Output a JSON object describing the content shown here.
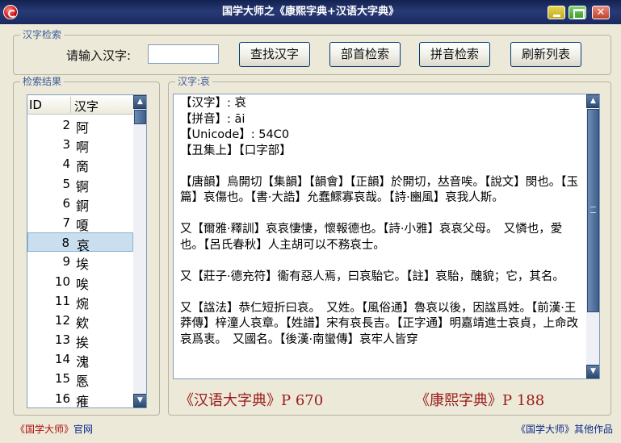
{
  "window": {
    "title": "国学大师之《康熙字典+汉语大字典》",
    "close_glyph": "✕",
    "colors": {
      "titlebar": "#1a2a60",
      "accent": "#9a1a1a",
      "selection": "#c9dff0"
    }
  },
  "search": {
    "group_label": "汉字检索",
    "prompt": "请输入汉字:",
    "input_value": "",
    "buttons": {
      "lookup": "查找汉字",
      "radical": "部首检索",
      "pinyin": "拼音检索",
      "refresh": "刷新列表"
    }
  },
  "results": {
    "group_label": "检索结果",
    "columns": [
      "ID",
      "汉字"
    ],
    "rows": [
      {
        "id": "2",
        "char": "阿"
      },
      {
        "id": "3",
        "char": "啊"
      },
      {
        "id": "4",
        "char": "啇"
      },
      {
        "id": "5",
        "char": "锕"
      },
      {
        "id": "6",
        "char": "錒"
      },
      {
        "id": "7",
        "char": "嗄"
      },
      {
        "id": "8",
        "char": "哀"
      },
      {
        "id": "9",
        "char": "埃"
      },
      {
        "id": "10",
        "char": "唉"
      },
      {
        "id": "11",
        "char": "焥"
      },
      {
        "id": "12",
        "char": "欸"
      },
      {
        "id": "13",
        "char": "挨"
      },
      {
        "id": "14",
        "char": "溾"
      },
      {
        "id": "15",
        "char": "悘"
      },
      {
        "id": "16",
        "char": "痽"
      }
    ],
    "selected_index": 6
  },
  "detail": {
    "group_label": "汉字:哀",
    "lines": [
      "【汉字】: 哀",
      "【拼音】: āi",
      "【Unicode】: 54C0",
      "【丑集上】【口字部】",
      "【唐韻】烏開切【集韻】【韻會】【正韻】於開切，𠀤音唉。【說文】閔也。【玉篇】哀傷也。【書·大誥】允蠢鰥寡哀哉。【詩·豳風】哀我人斯。",
      "又【爾雅·釋訓】哀哀悽悽，懷報德也。【詩·小雅】哀哀父母。　又憐也，愛也。【呂氏春秋】人主胡可以不務哀士。",
      "又【莊子·德充符】衞有惡人焉，曰哀駘它。【註】哀駘，醜貌；它，其名。",
      "又【諡法】恭仁短折曰哀。　又姓。【風俗通】魯哀以後，因諡爲姓。【前漢·王莽傳】梓潼人哀章。【姓譜】宋有哀長吉。【正字通】明嘉靖進士哀貞，上命改哀爲衷。　又國名。【後漢·南蠻傳】哀牢人皆穿"
    ]
  },
  "refs": {
    "hanyu": "《汉语大字典》P 670",
    "kangxi": "《康熙字典》P 188"
  },
  "footer": {
    "official_name": "《国学大师》",
    "official_suffix": "官网",
    "other_name": "《国学大师》",
    "other_suffix": "其他作品"
  }
}
